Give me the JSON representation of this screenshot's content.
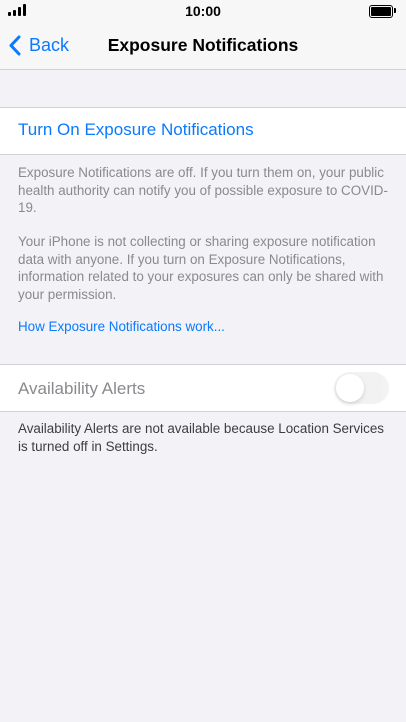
{
  "status_bar": {
    "time": "10:00",
    "signal_icon": "signal-bars-icon",
    "battery_icon": "battery-full-icon"
  },
  "nav": {
    "back_label": "Back",
    "back_icon": "chevron-left-icon",
    "title": "Exposure Notifications"
  },
  "exposure": {
    "turn_on_label": "Turn On Exposure Notifications",
    "footer_1": "Exposure Notifications are off. If you turn them on, your public health authority can notify you of possible exposure to COVID-19.",
    "footer_2": "Your iPhone is not collecting or sharing exposure notification data with anyone. If you turn on Exposure Notifications, information related to your exposures can only be shared with your permission.",
    "how_link": "How Exposure Notifications work..."
  },
  "availability": {
    "label": "Availability Alerts",
    "toggle_on": false,
    "footer": "Availability Alerts are not available because Location Services is turned off in Settings."
  },
  "colors": {
    "accent": "#0a7aff",
    "background": "#f2f2f7",
    "secondary_text": "#8a8a8e"
  }
}
